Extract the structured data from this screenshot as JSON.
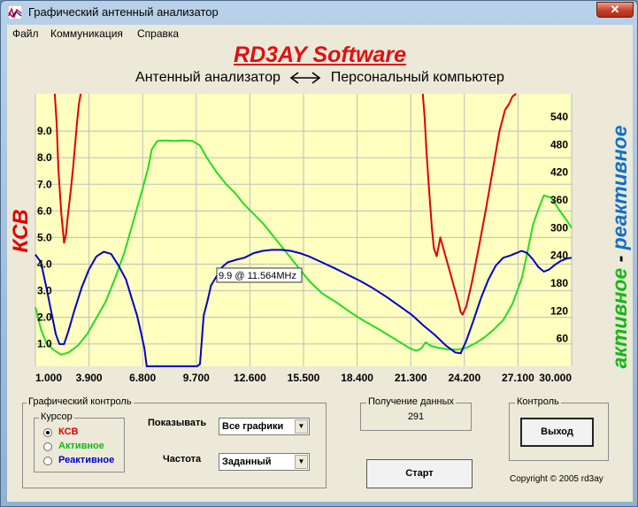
{
  "window": {
    "title": "Графический антенный анализатор",
    "close_glyph": "✕"
  },
  "menu": [
    {
      "label": "Файл"
    },
    {
      "label": "Коммуникация"
    },
    {
      "label": "Справка"
    }
  ],
  "brand": "RD3AY Software",
  "subtitle": {
    "left": "Антенный анализатор",
    "right": "Персональный компьютер"
  },
  "chart_data": {
    "type": "line",
    "left_axis_label": "КСВ",
    "right_axis_label_active": "активное",
    "right_axis_label_sep": " - ",
    "right_axis_label_reactive": "реактивное",
    "x_ticks": [
      "1.000",
      "3.900",
      "6.800",
      "9.700",
      "12.600",
      "15.500",
      "18.400",
      "21.300",
      "24.200",
      "27.100",
      "30.000"
    ],
    "left_ticks": [
      "1.0",
      "2.0",
      "3.0",
      "4.0",
      "5.0",
      "6.0",
      "7.0",
      "8.0",
      "9.0"
    ],
    "right_ticks": [
      "60",
      "120",
      "180",
      "240",
      "300",
      "360",
      "420",
      "480",
      "540"
    ],
    "xlim": [
      1.0,
      30.0
    ],
    "ylim_left": [
      0.16,
      10.4
    ],
    "ylim_right": [
      0,
      590
    ],
    "grid": true,
    "colors": {
      "swr": "#e00000",
      "active": "#22dd22",
      "reactive": "#0000c8",
      "background": "#ffffc0"
    },
    "tooltip": "9.9 @ 11.564MHz",
    "series": [
      {
        "name": "КСВ",
        "axis": "left",
        "color": "#e00000",
        "x": [
          2.05,
          2.15,
          2.25,
          2.4,
          2.55,
          2.65,
          2.75,
          2.85,
          2.95,
          3.05,
          3.15,
          3.25,
          3.35,
          3.45,
          21.95,
          22.05,
          22.15,
          22.3,
          22.45,
          22.55,
          22.7,
          22.9,
          23.1,
          23.3,
          23.5,
          23.7,
          23.9,
          24.0,
          24.1,
          24.3,
          24.6,
          25.0,
          25.4,
          25.8,
          26.1,
          26.4,
          26.6,
          26.8,
          27.0
        ],
        "y": [
          10.4,
          9.3,
          7.5,
          5.9,
          4.8,
          5.1,
          5.8,
          6.4,
          7.0,
          7.7,
          8.5,
          9.3,
          10.0,
          10.4,
          10.4,
          9.5,
          8.2,
          6.7,
          5.3,
          4.6,
          4.3,
          5.0,
          4.5,
          4.0,
          3.5,
          3.0,
          2.5,
          2.2,
          2.1,
          2.4,
          3.3,
          4.7,
          6.2,
          7.8,
          9.0,
          9.8,
          10.0,
          10.3,
          10.4
        ]
      },
      {
        "name": "Активное",
        "axis": "right",
        "color": "#22dd22",
        "x": [
          1.0,
          1.3,
          1.6,
          2.0,
          2.4,
          2.8,
          3.3,
          3.8,
          4.3,
          4.8,
          5.3,
          5.8,
          6.3,
          6.8,
          7.1,
          7.3,
          7.6,
          8.0,
          8.5,
          9.0,
          9.5,
          9.9,
          10.3,
          10.8,
          11.3,
          11.8,
          12.3,
          12.8,
          13.3,
          13.8,
          14.3,
          14.8,
          15.3,
          15.8,
          16.5,
          17.3,
          18.0,
          18.7,
          19.5,
          20.2,
          20.8,
          21.3,
          21.6,
          21.85,
          22.1,
          22.4,
          22.8,
          23.3,
          23.8,
          24.3,
          24.8,
          25.3,
          25.8,
          26.3,
          26.8,
          27.3,
          27.6,
          27.9,
          28.2,
          28.5,
          28.9,
          29.3,
          29.7,
          30.0
        ],
        "y": [
          128,
          80,
          50,
          35,
          25,
          30,
          45,
          70,
          105,
          140,
          190,
          245,
          315,
          385,
          430,
          470,
          488,
          489,
          488,
          489,
          488,
          478,
          450,
          420,
          395,
          375,
          350,
          330,
          310,
          285,
          260,
          235,
          210,
          185,
          158,
          138,
          118,
          100,
          82,
          65,
          50,
          38,
          34,
          38,
          52,
          44,
          40,
          37,
          36,
          40,
          50,
          63,
          80,
          100,
          135,
          190,
          245,
          305,
          340,
          370,
          365,
          340,
          318,
          300
        ]
      },
      {
        "name": "Реактивное",
        "axis": "right",
        "color": "#0000c8",
        "x": [
          1.0,
          1.3,
          1.6,
          1.9,
          2.1,
          2.3,
          2.55,
          2.8,
          3.1,
          3.5,
          3.9,
          4.3,
          4.7,
          5.1,
          5.5,
          5.9,
          6.2,
          6.5,
          6.7,
          6.9,
          7.02,
          7.04,
          9.58,
          9.62,
          9.75,
          9.9,
          10.1,
          10.3,
          10.5,
          10.8,
          11.1,
          11.4,
          11.8,
          12.3,
          12.8,
          13.3,
          13.8,
          14.3,
          14.8,
          15.3,
          15.8,
          16.5,
          17.2,
          17.9,
          18.6,
          19.3,
          20.0,
          20.7,
          21.4,
          22.0,
          22.6,
          23.2,
          23.7,
          24.0,
          24.3,
          24.7,
          25.1,
          25.5,
          25.9,
          26.3,
          26.7,
          27.0,
          27.3,
          27.6,
          27.9,
          28.2,
          28.5,
          28.8,
          29.1,
          29.4,
          29.7,
          30.0
        ],
        "y": [
          242,
          225,
          170,
          110,
          70,
          48,
          48,
          78,
          120,
          170,
          210,
          238,
          248,
          243,
          218,
          188,
          148,
          110,
          75,
          38,
          0,
          0,
          0,
          0,
          0,
          5,
          110,
          140,
          175,
          195,
          215,
          225,
          230,
          235,
          245,
          250,
          252,
          252,
          250,
          245,
          238,
          225,
          212,
          198,
          184,
          168,
          150,
          130,
          110,
          88,
          68,
          45,
          30,
          28,
          55,
          100,
          148,
          188,
          218,
          235,
          240,
          245,
          250,
          245,
          232,
          215,
          205,
          210,
          220,
          228,
          233,
          235
        ]
      }
    ]
  },
  "graph_control": {
    "title": "Графический контроль",
    "cursor_title": "Курсор",
    "options": [
      {
        "label": "КСВ",
        "color": "#e00000",
        "selected": true
      },
      {
        "label": "Активное",
        "color": "#14b814",
        "selected": false
      },
      {
        "label": "Реактивное",
        "color": "#0000c8",
        "selected": false
      }
    ],
    "show_label": "Показывать",
    "show_value": "Все графики",
    "freq_label": "Частота",
    "freq_value": "Заданный",
    "dd_glyph": "▼"
  },
  "data_recv": {
    "title": "Получение данных",
    "value": "291"
  },
  "start_button": "Старт",
  "control": {
    "title": "Контроль",
    "exit_button": "Выход"
  },
  "copyright": "Copyright © 2005 rd3ay"
}
